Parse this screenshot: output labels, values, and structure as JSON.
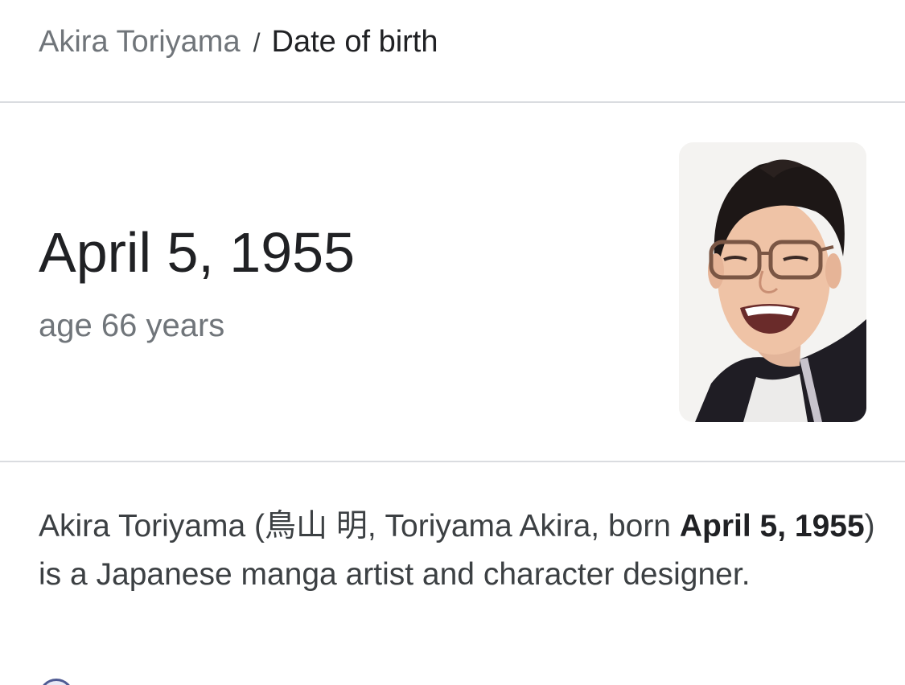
{
  "breadcrumb": {
    "parent": "Akira Toriyama",
    "separator": "/",
    "current": "Date of birth"
  },
  "answer": {
    "date": "April 5, 1955",
    "age": "age 66 years"
  },
  "photo": {
    "alt": "Akira Toriyama"
  },
  "description": {
    "part1": "Akira Toriyama (鳥山 明, Toriyama Akira, born ",
    "bold": "April 5, 1955",
    "part2": ") is a Japanese manga artist and character designer."
  },
  "icons": {
    "source": "source-favicon-icon"
  }
}
